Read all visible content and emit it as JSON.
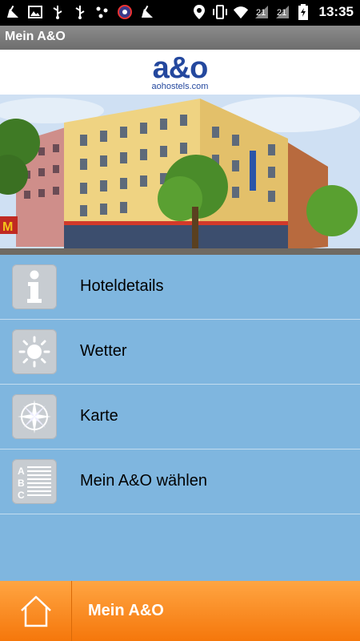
{
  "status_bar": {
    "time": "13:35",
    "icons": [
      "cleaner-icon",
      "image-icon",
      "usb-icon",
      "usb-icon",
      "dots-icon",
      "tracker-icon",
      "cleaner-icon",
      "location-icon",
      "vibrate-icon",
      "wifi-icon",
      "sim-icon",
      "sim-icon",
      "battery-icon"
    ],
    "sim_label_1": "21",
    "sim_label_2": "21"
  },
  "title_bar": {
    "title": "Mein A&O"
  },
  "logo": {
    "brand": "a&o",
    "url_text": "aohostels.com",
    "color": "#24489e"
  },
  "hero": {
    "image": "hotel-building-photo"
  },
  "menu": {
    "items": [
      {
        "label": "Hoteldetails",
        "icon": "info-icon"
      },
      {
        "label": "Wetter",
        "icon": "sun-icon"
      },
      {
        "label": "Karte",
        "icon": "compass-icon"
      },
      {
        "label": "Mein A&O wählen",
        "icon": "list-abc-icon"
      }
    ]
  },
  "bottom_bar": {
    "title": "Mein A&O",
    "home_icon": "home-icon",
    "color": "#f5770b"
  }
}
